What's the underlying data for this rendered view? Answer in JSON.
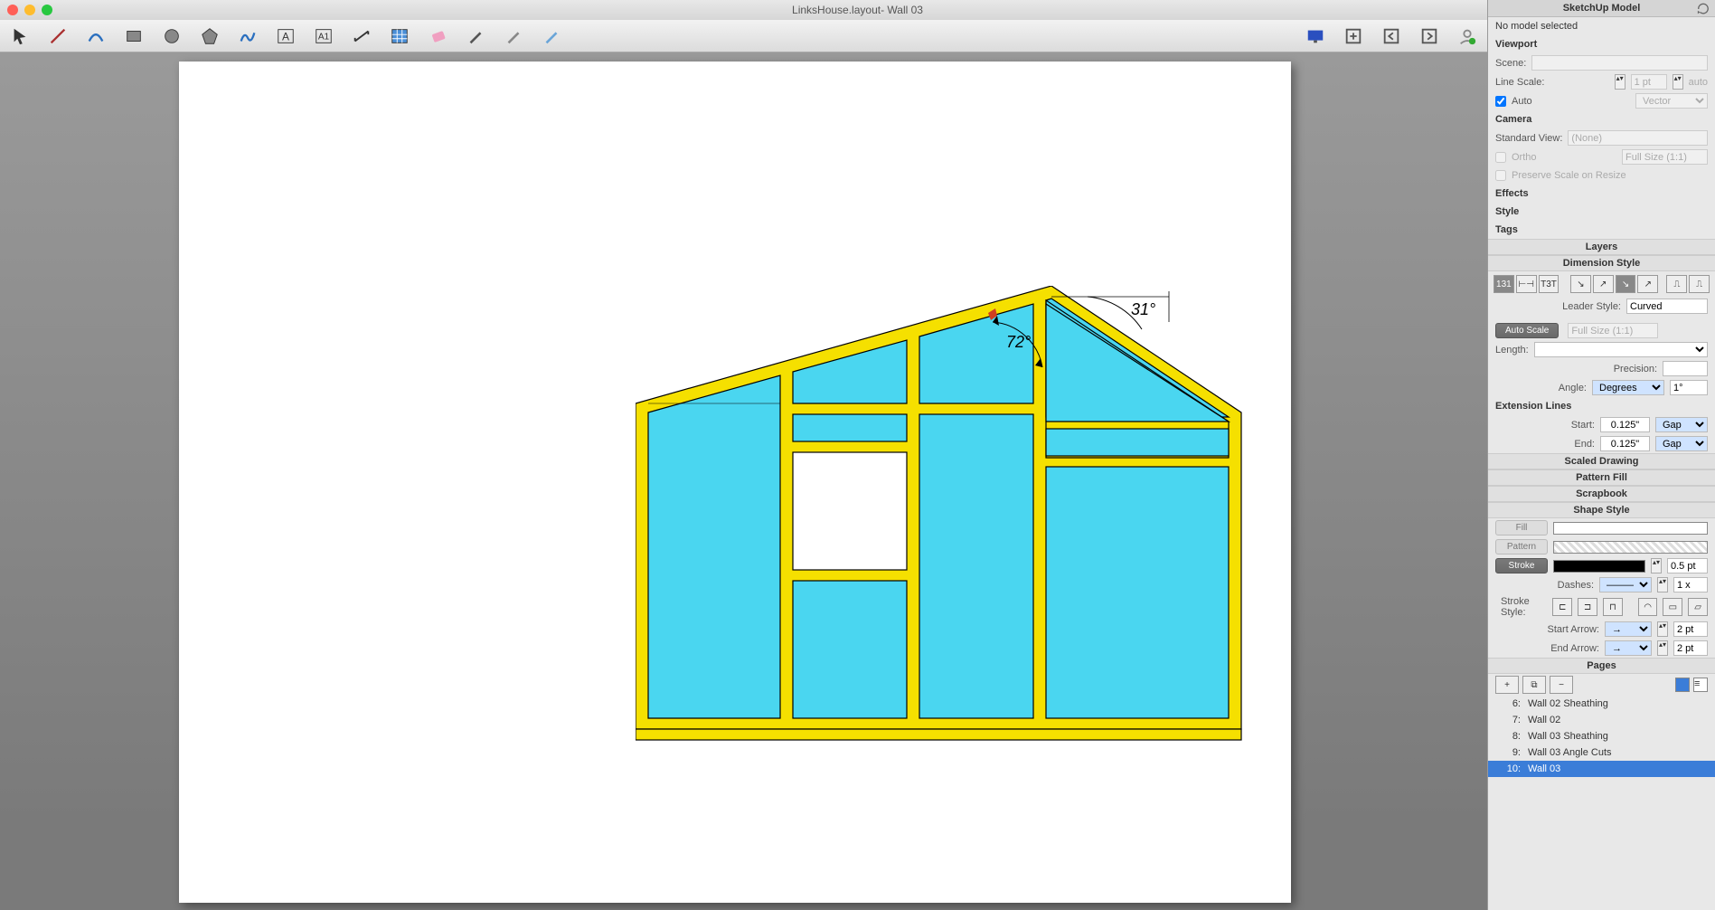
{
  "titlebar": {
    "title": "LinksHouse.layout- Wall 03"
  },
  "panel": {
    "header": "SketchUp Model",
    "no_model": "No model selected",
    "viewport": {
      "title": "Viewport",
      "scene_label": "Scene:",
      "line_scale_label": "Line Scale:",
      "line_scale_value": "1 pt",
      "line_scale_mode": "auto",
      "auto_label": "Auto",
      "render_mode": "Vector"
    },
    "camera": {
      "title": "Camera",
      "std_view_label": "Standard View:",
      "std_view_value": "(None)",
      "ortho_label": "Ortho",
      "scale_value": "Full Size (1:1)",
      "preserve_label": "Preserve Scale on Resize"
    },
    "effects": "Effects",
    "style": "Style",
    "tags": "Tags",
    "layers": "Layers",
    "dim_style": {
      "title": "Dimension Style",
      "leader_label": "Leader Style:",
      "leader_value": "Curved",
      "autoscale": "Auto Scale",
      "fullsize": "Full Size (1:1)",
      "length_label": "Length:",
      "precision_label": "Precision:",
      "angle_label": "Angle:",
      "angle_unit": "Degrees",
      "angle_precision": "1°"
    },
    "ext_lines": {
      "title": "Extension Lines",
      "start_label": "Start:",
      "start_value": "0.125\"",
      "start_gap": "Gap",
      "end_label": "End:",
      "end_value": "0.125\"",
      "end_gap": "Gap"
    },
    "scaled_drawing": "Scaled Drawing",
    "pattern_fill": "Pattern Fill",
    "scrapbook": "Scrapbook",
    "shape_style": {
      "title": "Shape Style",
      "fill": "Fill",
      "pattern": "Pattern",
      "stroke": "Stroke",
      "stroke_width": "0.5 pt",
      "dashes_label": "Dashes:",
      "dashes_scale": "1 x",
      "stroke_style_label": "Stroke Style:",
      "start_arrow_label": "Start Arrow:",
      "start_arrow_size": "2 pt",
      "end_arrow_label": "End Arrow:",
      "end_arrow_size": "2 pt"
    },
    "pages": {
      "title": "Pages",
      "items": [
        {
          "num": "6:",
          "name": "Wall 02 Sheathing"
        },
        {
          "num": "7:",
          "name": "Wall 02"
        },
        {
          "num": "8:",
          "name": "Wall 03 Sheathing"
        },
        {
          "num": "9:",
          "name": "Wall 03 Angle Cuts"
        },
        {
          "num": "10:",
          "name": "Wall 03"
        }
      ]
    }
  },
  "drawing": {
    "angle1": "72°",
    "angle2": "31°"
  }
}
